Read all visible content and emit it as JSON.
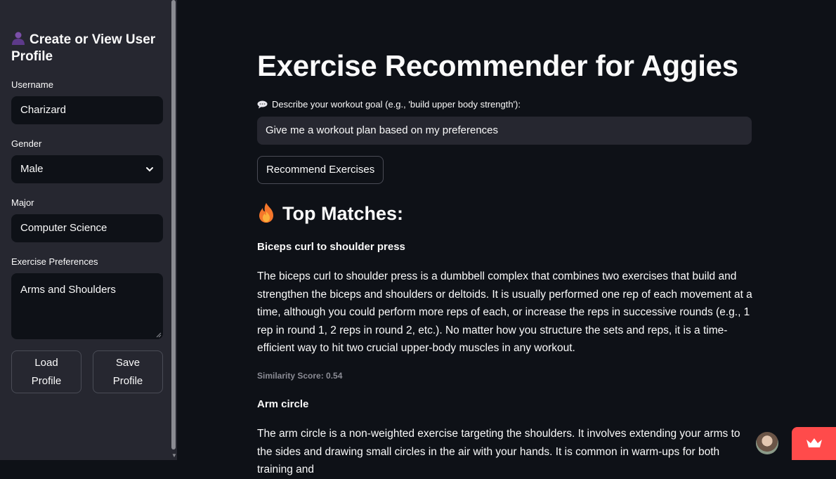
{
  "sidebar": {
    "title": "Create or View User Profile",
    "username": {
      "label": "Username",
      "value": "Charizard"
    },
    "gender": {
      "label": "Gender",
      "value": "Male"
    },
    "major": {
      "label": "Major",
      "value": "Computer Science"
    },
    "preferences": {
      "label": "Exercise Preferences",
      "value": "Arms and Shoulders"
    },
    "load_button": [
      "Load",
      "Profile"
    ],
    "save_button": [
      "Save",
      "Profile"
    ]
  },
  "main": {
    "title": "Exercise Recommender for Aggies",
    "goal_label": "Describe your workout goal (e.g., 'build upper body strength'):",
    "goal_value": "Give me a workout plan based on my preferences",
    "recommend_button": "Recommend Exercises",
    "matches_heading": "Top Matches:",
    "results": [
      {
        "name": "Biceps curl to shoulder press",
        "description": "The biceps curl to shoulder press is a dumbbell complex that combines two exercises that build and strengthen the biceps and shoulders or deltoids. It is usually performed one rep of each movement at a time, although you could perform more reps of each, or increase the reps in successive rounds (e.g., 1 rep in round 1, 2 reps in round 2, etc.). No matter how you structure the sets and reps, it is a time-efficient way to hit two crucial upper-body muscles in any workout.",
        "score": "Similarity Score: 0.54"
      },
      {
        "name": "Arm circle",
        "description": "The arm circle is a non-weighted exercise targeting the shoulders. It involves extending your arms to the sides and drawing small circles in the air with your hands. It is common in warm-ups for both training and"
      }
    ]
  },
  "colors": {
    "background": "#0e1117",
    "sidebar": "#262730",
    "accent": "#ff4b4b",
    "muted_text": "#8b8c95"
  },
  "icons": [
    "user-icon",
    "chat-icon",
    "fire-icon",
    "chevron-down-icon",
    "crown-icon"
  ]
}
